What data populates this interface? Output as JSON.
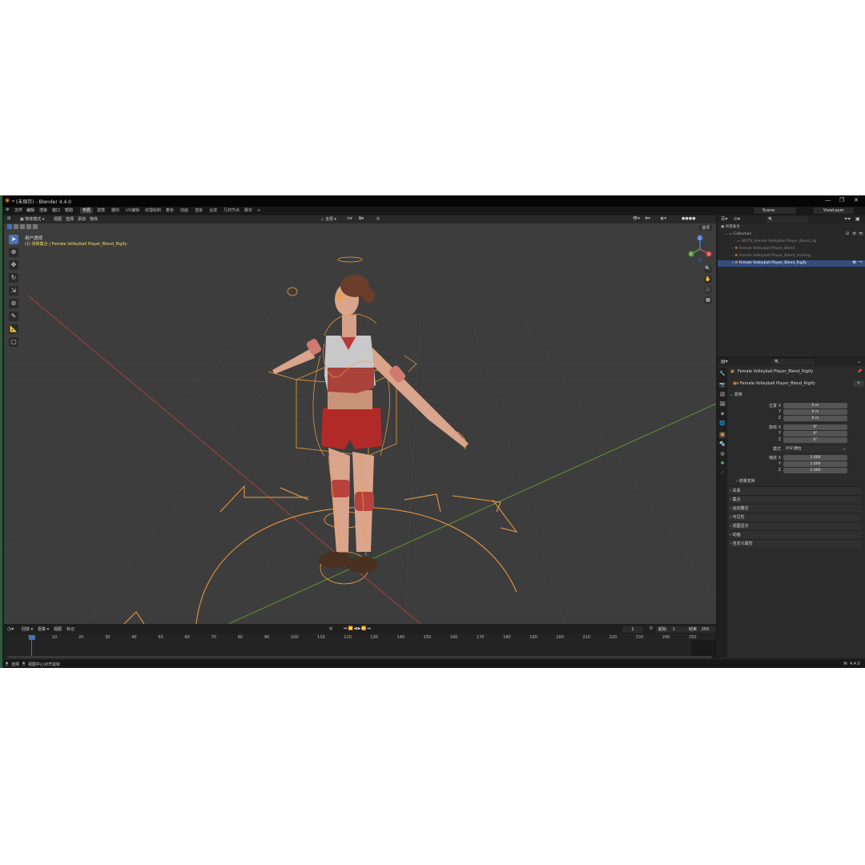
{
  "window": {
    "title": "* (未保存) - Blender 4.4.0",
    "min_icon": "minimize-icon",
    "max_icon": "maximize-icon",
    "close_icon": "close-icon"
  },
  "menubar": {
    "menus": [
      "文件",
      "编辑",
      "渲染",
      "窗口",
      "帮助"
    ],
    "workspaces": [
      "布局",
      "建模",
      "雕刻",
      "UV编辑",
      "纹理绘制",
      "着色",
      "动画",
      "渲染",
      "合成",
      "几何节点",
      "脚本"
    ],
    "active_workspace": "布局",
    "add_tab": "+",
    "scene": "Scene",
    "view_layer": "ViewLayer"
  },
  "viewport": {
    "mode": "物体模式",
    "menus": [
      "视图",
      "选择",
      "添加",
      "物体"
    ],
    "transform_orientation": "全局",
    "options": "选项",
    "overlay_title": "用户透视",
    "overlay_sub": "(1) 场景集合 | Female Volleyball Player_Blend_Rigify",
    "gizmo": {
      "x": "X",
      "y": "Y",
      "z": "Z"
    }
  },
  "outliner": {
    "search_placeholder": "",
    "rows": [
      {
        "label": "场景集合",
        "icon": "scene-collection-icon"
      },
      {
        "label": "Collection",
        "icon": "collection-icon"
      },
      {
        "label": "WGTS_Female Volleyball Player_Blend_rig",
        "icon": "collection-icon"
      },
      {
        "label": "Female Volleyball Player_Blend",
        "icon": "armature-icon"
      },
      {
        "label": "Female Volleyball Player_Blend_metarig",
        "icon": "armature-icon"
      },
      {
        "label": "Female Volleyball Player_Blend_Rigify",
        "icon": "armature-icon"
      }
    ]
  },
  "properties": {
    "search_placeholder": "",
    "object_name": "Female Volleyball Player_Blend_Rigify",
    "datablock_name": "Female Volleyball Player_Blend_Rigify",
    "transform_header": "变换",
    "location_label": "位置 X",
    "rotation_label": "旋转 X",
    "mode_label": "模式",
    "mode_value": "XYZ 欧拉",
    "scale_label": "缩放 X",
    "axis_y": "Y",
    "axis_z": "Z",
    "location": [
      "0 m",
      "0 m",
      "0 m"
    ],
    "rotation": [
      "0°",
      "0°",
      "0°"
    ],
    "scale": [
      "1.000",
      "1.000",
      "1.000"
    ],
    "delta_transform": "增量变换",
    "panels": [
      "关系",
      "集合",
      "运动路径",
      "可见性",
      "视图显示",
      "动画",
      "自定义属性"
    ]
  },
  "timeline": {
    "menus": [
      "回放",
      "抠像",
      "视图",
      "标记"
    ],
    "current_frame": "1",
    "start_label": "起始",
    "start": "1",
    "end_label": "结束",
    "end": "250",
    "ticks": [
      "1",
      "10",
      "20",
      "30",
      "40",
      "50",
      "60",
      "70",
      "80",
      "90",
      "100",
      "110",
      "120",
      "130",
      "140",
      "150",
      "160",
      "170",
      "180",
      "190",
      "200",
      "210",
      "220",
      "230",
      "240",
      "250"
    ]
  },
  "statusbar": {
    "select": "选择",
    "center_view": "视图中心对齐鼠标",
    "version": "4.4.0"
  },
  "colors": {
    "accent": "#4772b3",
    "selection_orange": "#f0a040",
    "viewport_bg": "#3d3d3d"
  }
}
